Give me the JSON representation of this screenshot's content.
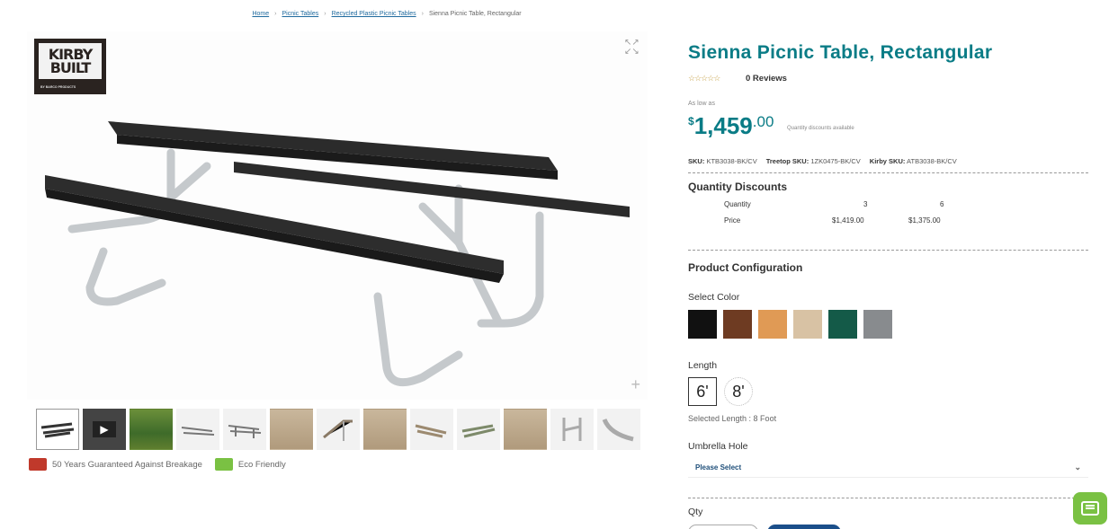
{
  "breadcrumb": {
    "items": [
      "Home",
      "Picnic Tables",
      "Recycled Plastic Picnic Tables",
      "Sienna Picnic Table, Rectangular"
    ],
    "separator": "›"
  },
  "gallery": {
    "logo_line1": "KIRBY",
    "logo_line2": "BUILT",
    "logo_sub": "BY BARCO PRODUCTS",
    "expand_glyph": "↖↗\n↙↘",
    "zoom_glyph": "+",
    "thumbnail_count": 14,
    "play_glyph": "▶"
  },
  "badges": [
    {
      "label": "50 Years Guaranteed Against Breakage",
      "icon": "shield-icon",
      "color": "#c0392b"
    },
    {
      "label": "Eco Friendly",
      "icon": "leaf-icon",
      "color": "#7ac143"
    }
  ],
  "product": {
    "title": "Sienna Picnic Table, Rectangular",
    "stars": "☆☆☆☆☆",
    "reviews": "0 Reviews",
    "as_low_as": "As low as",
    "price_currency": "$",
    "price_whole": "1,459",
    "price_cents": ".00",
    "discount_note": "Quantity discounts available",
    "sku_label": "SKU:",
    "sku": "KTB3038-BK/CV",
    "treetop_label": "Treetop SKU:",
    "treetop_sku": "1ZK0475-BK/CV",
    "kirby_label": "Kirby SKU:",
    "kirby_sku": "ATB3038-BK/CV"
  },
  "quantity_discounts": {
    "title": "Quantity Discounts",
    "qty_label": "Quantity",
    "price_label": "Price",
    "tiers": [
      {
        "qty": "3",
        "price": "$1,419.00"
      },
      {
        "qty": "6",
        "price": "$1,375.00"
      }
    ]
  },
  "config": {
    "title": "Product Configuration",
    "color_label": "Select Color",
    "colors": [
      {
        "name": "black",
        "hex": "#111111"
      },
      {
        "name": "brown",
        "hex": "#6e3b22"
      },
      {
        "name": "cedar",
        "hex": "#e09a55"
      },
      {
        "name": "sand",
        "hex": "#d8c2a4"
      },
      {
        "name": "green",
        "hex": "#145a48"
      },
      {
        "name": "gray",
        "hex": "#888b8e"
      }
    ],
    "length_label": "Length",
    "lengths": [
      "6'",
      "8'"
    ],
    "selected_length": "Selected Length : 8 Foot",
    "umbrella_label": "Umbrella Hole",
    "umbrella_value": "Please Select",
    "umbrella_chevron": "⌄",
    "qty_label": "Qty"
  },
  "colors": {
    "accent": "#0a7c86",
    "link": "#1f6a9e",
    "button": "#1b4f8a",
    "chat": "#7ac143"
  }
}
